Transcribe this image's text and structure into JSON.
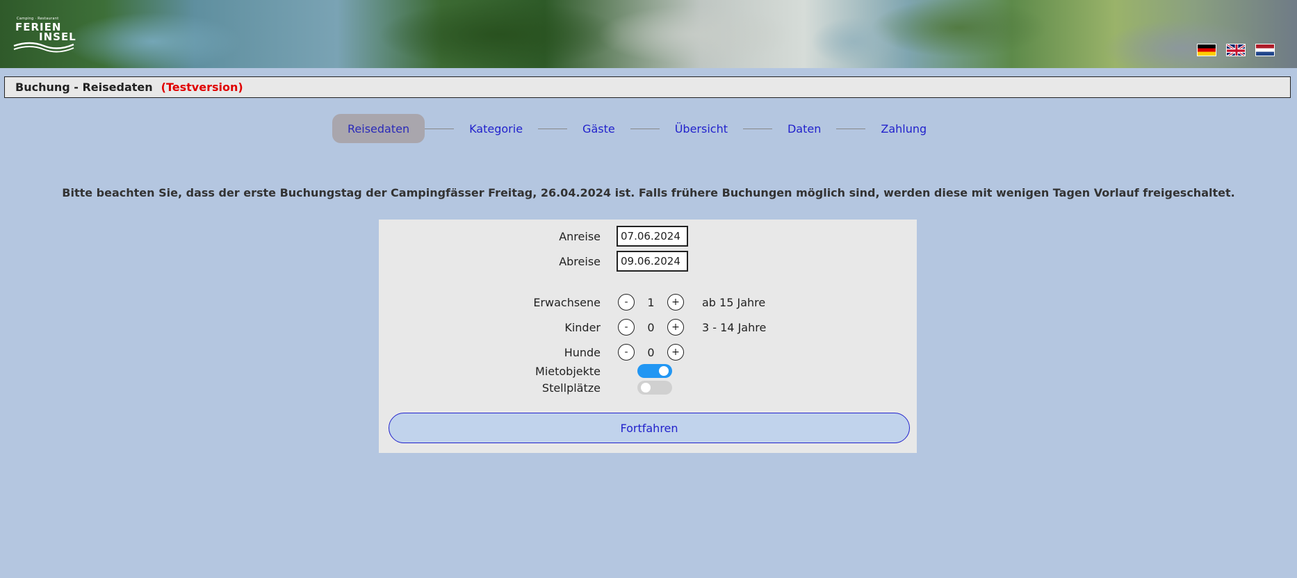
{
  "header": {
    "logo_small": "Camping · Restaurant",
    "logo_line1": "FERIEN",
    "logo_line2": "INSEL",
    "flags": [
      {
        "name": "german-flag-icon"
      },
      {
        "name": "english-flag-icon"
      },
      {
        "name": "dutch-flag-icon"
      }
    ]
  },
  "titlebar": {
    "title": "Buchung - Reisedaten",
    "badge": "(Testversion)"
  },
  "steps": [
    {
      "label": "Reisedaten",
      "active": true
    },
    {
      "label": "Kategorie",
      "active": false
    },
    {
      "label": "Gäste",
      "active": false
    },
    {
      "label": "Übersicht",
      "active": false
    },
    {
      "label": "Daten",
      "active": false
    },
    {
      "label": "Zahlung",
      "active": false
    }
  ],
  "notice": "Bitte beachten Sie, dass der erste Buchungstag der Campingfässer Freitag, 26.04.2024 ist. Falls frühere Buchungen möglich sind, werden diese mit wenigen Tagen Vorlauf freigeschaltet.",
  "form": {
    "arrival_label": "Anreise",
    "arrival_value": "07.06.2024",
    "departure_label": "Abreise",
    "departure_value": "09.06.2024",
    "adults_label": "Erwachsene",
    "adults_value": "1",
    "adults_hint": "ab 15 Jahre",
    "children_label": "Kinder",
    "children_value": "0",
    "children_hint": "3 - 14 Jahre",
    "dogs_label": "Hunde",
    "dogs_value": "0",
    "minus": "-",
    "plus": "+",
    "rentals_label": "Mietobjekte",
    "rentals_on": true,
    "pitches_label": "Stellplätze",
    "pitches_on": false,
    "continue_label": "Fortfahren"
  },
  "colors": {
    "background": "#b4c6e0",
    "link": "#2222cc",
    "test_badge": "#e00000",
    "toggle_on": "#2196f3"
  }
}
